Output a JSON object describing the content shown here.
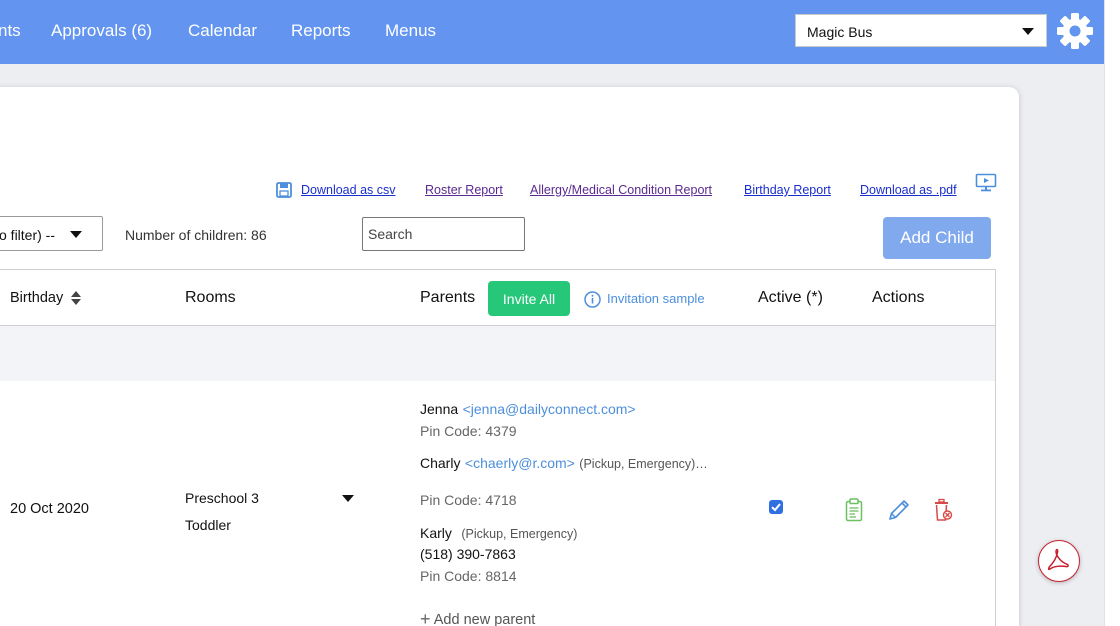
{
  "nav": {
    "items": [
      {
        "label": "nts",
        "name": "nav-item-events"
      },
      {
        "label": "Approvals (6)",
        "name": "nav-item-approvals"
      },
      {
        "label": "Calendar",
        "name": "nav-item-calendar"
      },
      {
        "label": "Reports",
        "name": "nav-item-reports"
      },
      {
        "label": "Menus",
        "name": "nav-item-menus"
      }
    ],
    "school": "Magic Bus",
    "settings_icon": "gear-icon"
  },
  "toolbar": {
    "download_csv": "Download as csv",
    "roster_report": "Roster Report",
    "allergy_report": "Allergy/Medical Condition Report",
    "birthday_report": "Birthday Report",
    "download_pdf": "Download as .pdf",
    "icons": {
      "csv": "floppy-disk-icon",
      "present": "monitor-icon"
    }
  },
  "controls": {
    "filter_value": "o filter) --",
    "children_count": "Number of children: 86",
    "search_placeholder": "Search",
    "add_child": "Add Child"
  },
  "table": {
    "headers": {
      "birthday": "Birthday",
      "rooms": "Rooms",
      "parents": "Parents",
      "invite_all": "Invite All",
      "invitation_sample": "Invitation sample",
      "active": "Active (*)",
      "actions": "Actions"
    },
    "row": {
      "birthday": "20 Oct 2020",
      "rooms": [
        "Preschool 3",
        "Toddler"
      ],
      "parents": [
        {
          "name": "Jenna",
          "email": "<jenna@dailyconnect.com>",
          "tags": "",
          "phone": "",
          "pin": "Pin Code: 4379"
        },
        {
          "name": "Charly",
          "email": "<chaerly@r.com>",
          "tags": "(Pickup, Emergency)…",
          "phone": "",
          "pin": "Pin Code: 4718"
        },
        {
          "name": "Karly",
          "email": "",
          "tags": "(Pickup, Emergency)",
          "phone": "(518) 390-7863",
          "pin": "Pin Code: 8814"
        }
      ],
      "add_parent": "Add new parent",
      "active": true
    }
  },
  "colors": {
    "navbar": "#6294f0",
    "invite_all": "#27c779",
    "add_child": "#80a9ee",
    "link": "#4d8fdc",
    "clipboard": "#6cbf63",
    "delete": "#d84a4a",
    "pdf": "#c8202f"
  }
}
